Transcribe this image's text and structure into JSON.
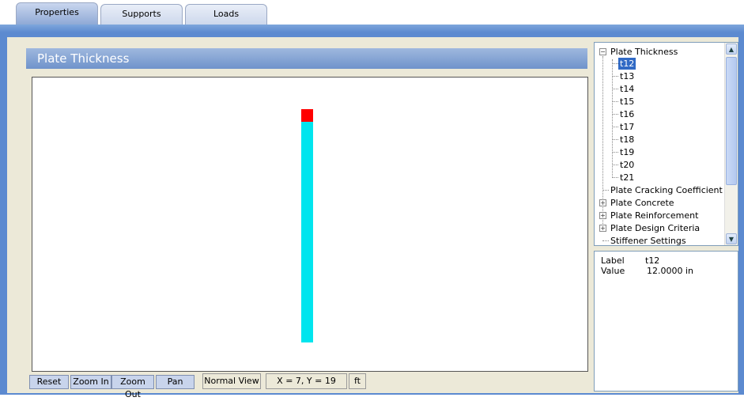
{
  "tabs": [
    {
      "label": "Properties",
      "active": true
    },
    {
      "label": "Supports",
      "active": false
    },
    {
      "label": "Loads",
      "active": false
    }
  ],
  "title": "Plate Thickness",
  "canvas": {
    "colors": {
      "top_segment": "#ff0000",
      "main_segment": "#00e5ee"
    }
  },
  "toolbar": {
    "reset": "Reset",
    "zoom_in": "Zoom In",
    "zoom_out": "Zoom Out",
    "pan": "Pan",
    "view_mode": "Normal View",
    "coords": "X = 7, Y = 19",
    "units": "ft"
  },
  "tree": {
    "root": "Plate Thickness",
    "children": [
      "t12",
      "t13",
      "t14",
      "t15",
      "t16",
      "t17",
      "t18",
      "t19",
      "t20",
      "t21"
    ],
    "selected": "t12",
    "siblings": [
      {
        "label": "Plate Cracking Coefficient",
        "expandable": false
      },
      {
        "label": "Plate Concrete",
        "expandable": true
      },
      {
        "label": "Plate Reinforcement",
        "expandable": true
      },
      {
        "label": "Plate Design Criteria",
        "expandable": true
      },
      {
        "label": "Stiffener Settings",
        "expandable": false
      }
    ]
  },
  "properties": {
    "label_key": "Label",
    "label_value": "t12",
    "value_key": "Value",
    "value_value": "12.0000 in"
  },
  "colors": {
    "accent": "#5c8ad0",
    "selection": "#316ac5"
  }
}
